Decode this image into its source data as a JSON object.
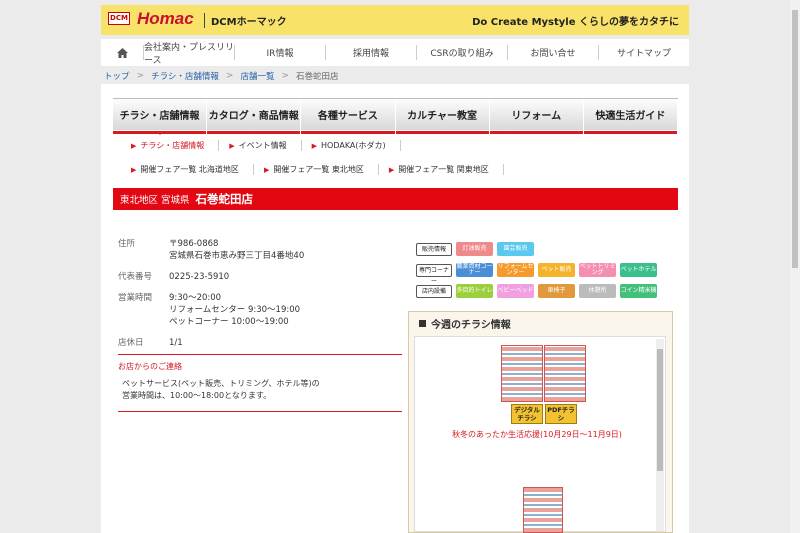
{
  "header": {
    "logo_box": "DCM",
    "logo_main": "Homac",
    "logo_sub": "DCMホーマック",
    "tagline": "Do Create Mystyle  くらしの夢をカタチに"
  },
  "gnav": {
    "items": [
      "会社案内・プレスリリース",
      "IR情報",
      "採用情報",
      "CSRの取り組み",
      "お問い合せ",
      "サイトマップ"
    ]
  },
  "breadcrumb": {
    "items": [
      "トップ",
      "チラシ・店舗情報",
      "店舗一覧",
      "石巻蛇田店"
    ]
  },
  "categories": [
    "チラシ・店舗情報",
    "カタログ・商品情報",
    "各種サービス",
    "カルチャー教室",
    "リフォーム",
    "快適生活ガイド"
  ],
  "subnav1": [
    "チラシ・店舗情報",
    "イベント情報",
    "HODAKA(ホダカ)"
  ],
  "subnav2": [
    "開催フェア一覧  北海道地区",
    "開催フェア一覧  東北地区",
    "開催フェア一覧  関東地区"
  ],
  "region": {
    "area": "東北地区  宮城県",
    "store": "石巻蛇田店"
  },
  "info": {
    "address_label": "住所",
    "postal": "〒986-0868",
    "address": "宮城県石巻市恵み野三丁目4番地40",
    "phone_label": "代表番号",
    "phone": "0225-23-5910",
    "hours_label": "営業時間",
    "hours1": "9:30〜20:00",
    "hours2": "リフォームセンター 9:30〜19:00",
    "hours3": "ペットコーナー 10:00〜19:00",
    "closed_label": "店休日",
    "closed": "1/1"
  },
  "notice": {
    "title": "お店からのご連絡",
    "line1": "ペットサービス(ペット販売、トリミング、ホテル等)の",
    "line2": "営業時間は、10:00〜18:00となります。"
  },
  "services": {
    "row1_label": "販売情報",
    "row1": [
      {
        "text": "灯油販売",
        "color": "#f08a8a"
      },
      {
        "text": "園芸販売",
        "color": "#5bc8ee"
      }
    ],
    "row2_label": "専門コーナー",
    "row2": [
      {
        "text": "農業資材コーナー",
        "color": "#4a8fd6"
      },
      {
        "text": "リフォームセンター",
        "color": "#f59a2b"
      },
      {
        "text": "ペット販売",
        "color": "#f5b22b"
      },
      {
        "text": "ペットトリミング",
        "color": "#f58fb0"
      },
      {
        "text": "ペットホテル",
        "color": "#3bbf8e"
      }
    ],
    "row3_label": "店内設備",
    "row3": [
      {
        "text": "多目的トイレ",
        "color": "#9ccf3c"
      },
      {
        "text": "ベビーベッド",
        "color": "#f0a0e0"
      },
      {
        "text": "車椅子",
        "color": "#e09a3c"
      },
      {
        "text": "休憩所",
        "color": "#bbbbbb"
      },
      {
        "text": "コイン精米機",
        "color": "#43c07a"
      }
    ]
  },
  "flyer": {
    "title": "今週のチラシ情報",
    "digital_btn": "デジタルチラシ",
    "pdf_btn": "PDFチラシ",
    "caption": "秋冬のあったか生活応援(10月29日〜11月9日)"
  }
}
